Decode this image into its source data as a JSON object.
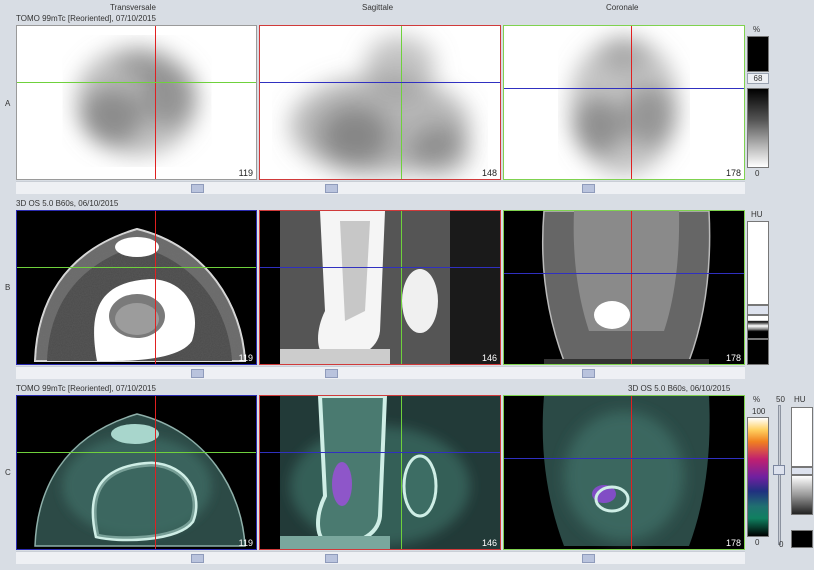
{
  "columns": {
    "transverse": "Transversale",
    "sagittal": "Sagittale",
    "coronal": "Coronale"
  },
  "rows": {
    "A": {
      "label": "A",
      "series": "TOMO 99mTc [Reoriented], 07/10/2015"
    },
    "B": {
      "label": "B",
      "series": "3D  OS  5.0  B60s, 06/10/2015"
    },
    "C": {
      "label": "C",
      "series_left": "TOMO 99mTc [Reoriented], 07/10/2015",
      "series_right": "3D  OS  5.0  B60s, 06/10/2015"
    }
  },
  "slices": {
    "A": [
      "119",
      "148",
      "178"
    ],
    "B": [
      "119",
      "146",
      "178"
    ],
    "C": [
      "119",
      "146",
      "178"
    ]
  },
  "colorbars": {
    "A": {
      "unit": "%",
      "value": "68",
      "min": "0"
    },
    "B": {
      "unit": "HU"
    },
    "C": {
      "unit": "%",
      "max": "100",
      "min": "0",
      "slider": "50",
      "unit2": "HU",
      "min2": "0"
    }
  },
  "colors": {
    "transverse_border": "#2a2ab0",
    "sagittal_border": "#c03030",
    "coronal_border": "#6fcf3f",
    "cross_red": "#e02020",
    "cross_green": "#6fd13c",
    "cross_blue": "#3030c0"
  }
}
